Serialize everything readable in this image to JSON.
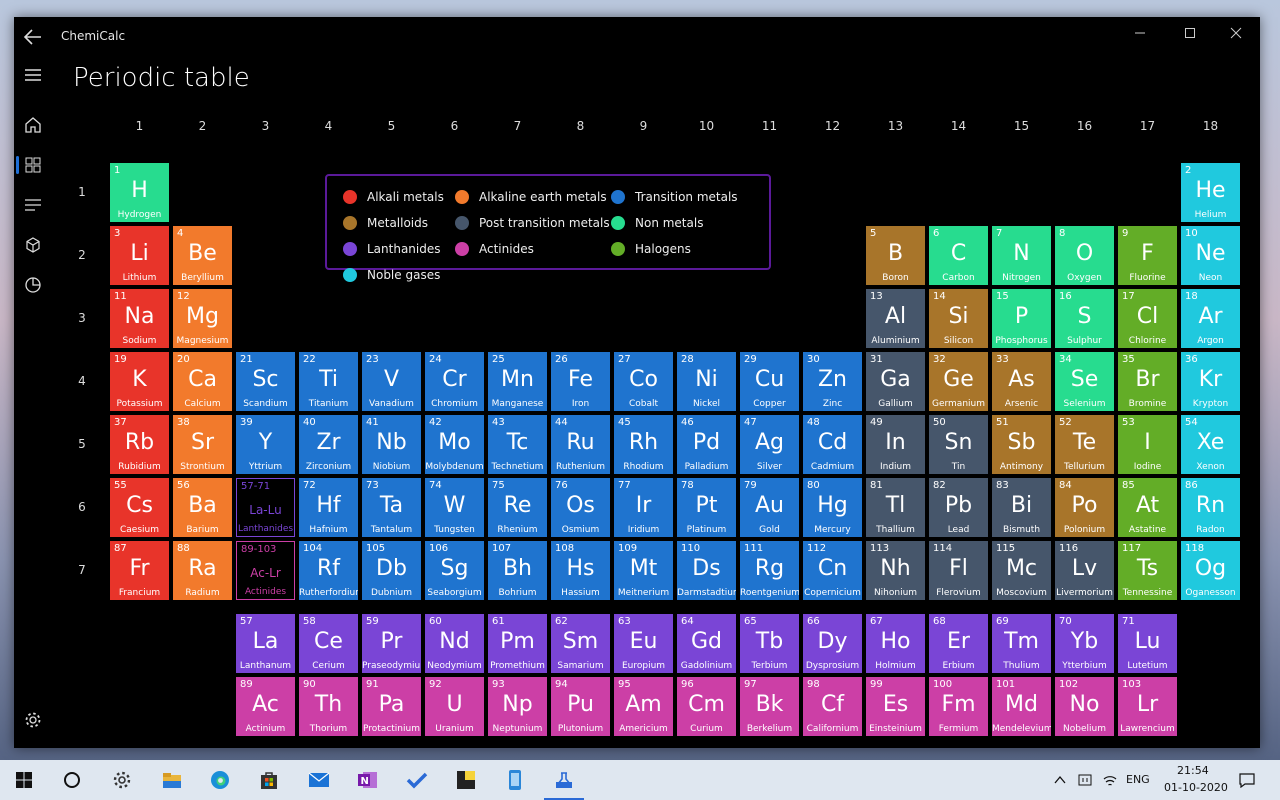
{
  "app": {
    "title": "ChemiCalc",
    "page_title": "Periodic table"
  },
  "nav": {
    "items": [
      "home-icon",
      "grid-icon",
      "list-icon",
      "cube-icon",
      "pie-chart-icon"
    ],
    "selected": "grid-icon",
    "settings_icon": "gear-icon"
  },
  "groups": [
    "1",
    "2",
    "3",
    "4",
    "5",
    "6",
    "7",
    "8",
    "9",
    "10",
    "11",
    "12",
    "13",
    "14",
    "15",
    "16",
    "17",
    "18"
  ],
  "periods": [
    "1",
    "2",
    "3",
    "4",
    "5",
    "6",
    "7"
  ],
  "legend": [
    {
      "label": "Alkali metals",
      "color": "#e8342a"
    },
    {
      "label": "Alkaline earth metals",
      "color": "#f27a2c"
    },
    {
      "label": "Transition metals",
      "color": "#1f74cf"
    },
    {
      "label": "Metalloids",
      "color": "#a8752a"
    },
    {
      "label": "Post transition metals",
      "color": "#46566b"
    },
    {
      "label": "Non metals",
      "color": "#27dc8f"
    },
    {
      "label": "Lanthanides",
      "color": "#7a45d6"
    },
    {
      "label": "Actinides",
      "color": "#cc3fa6"
    },
    {
      "label": "Halogens",
      "color": "#63ad27"
    },
    {
      "label": "Noble gases",
      "color": "#20c9de"
    }
  ],
  "category_colors": {
    "alkali": "#e8342a",
    "alkaline": "#f27a2c",
    "transition": "#1f74cf",
    "metalloid": "#a8752a",
    "post": "#46566b",
    "nonmetal": "#27dc8f",
    "lanthanide": "#7a45d6",
    "actinide": "#cc3fa6",
    "halogen": "#63ad27",
    "noble": "#20c9de"
  },
  "elements": [
    {
      "n": "1",
      "s": "H",
      "name": "Hydrogen",
      "g": 1,
      "p": 1,
      "c": "nonmetal"
    },
    {
      "n": "2",
      "s": "He",
      "name": "Helium",
      "g": 18,
      "p": 1,
      "c": "noble"
    },
    {
      "n": "3",
      "s": "Li",
      "name": "Lithium",
      "g": 1,
      "p": 2,
      "c": "alkali"
    },
    {
      "n": "4",
      "s": "Be",
      "name": "Beryllium",
      "g": 2,
      "p": 2,
      "c": "alkaline"
    },
    {
      "n": "5",
      "s": "B",
      "name": "Boron",
      "g": 13,
      "p": 2,
      "c": "metalloid"
    },
    {
      "n": "6",
      "s": "C",
      "name": "Carbon",
      "g": 14,
      "p": 2,
      "c": "nonmetal"
    },
    {
      "n": "7",
      "s": "N",
      "name": "Nitrogen",
      "g": 15,
      "p": 2,
      "c": "nonmetal"
    },
    {
      "n": "8",
      "s": "O",
      "name": "Oxygen",
      "g": 16,
      "p": 2,
      "c": "nonmetal"
    },
    {
      "n": "9",
      "s": "F",
      "name": "Fluorine",
      "g": 17,
      "p": 2,
      "c": "halogen"
    },
    {
      "n": "10",
      "s": "Ne",
      "name": "Neon",
      "g": 18,
      "p": 2,
      "c": "noble"
    },
    {
      "n": "11",
      "s": "Na",
      "name": "Sodium",
      "g": 1,
      "p": 3,
      "c": "alkali"
    },
    {
      "n": "12",
      "s": "Mg",
      "name": "Magnesium",
      "g": 2,
      "p": 3,
      "c": "alkaline"
    },
    {
      "n": "13",
      "s": "Al",
      "name": "Aluminium",
      "g": 13,
      "p": 3,
      "c": "post"
    },
    {
      "n": "14",
      "s": "Si",
      "name": "Silicon",
      "g": 14,
      "p": 3,
      "c": "metalloid"
    },
    {
      "n": "15",
      "s": "P",
      "name": "Phosphorus",
      "g": 15,
      "p": 3,
      "c": "nonmetal"
    },
    {
      "n": "16",
      "s": "S",
      "name": "Sulphur",
      "g": 16,
      "p": 3,
      "c": "nonmetal"
    },
    {
      "n": "17",
      "s": "Cl",
      "name": "Chlorine",
      "g": 17,
      "p": 3,
      "c": "halogen"
    },
    {
      "n": "18",
      "s": "Ar",
      "name": "Argon",
      "g": 18,
      "p": 3,
      "c": "noble"
    },
    {
      "n": "19",
      "s": "K",
      "name": "Potassium",
      "g": 1,
      "p": 4,
      "c": "alkali"
    },
    {
      "n": "20",
      "s": "Ca",
      "name": "Calcium",
      "g": 2,
      "p": 4,
      "c": "alkaline"
    },
    {
      "n": "21",
      "s": "Sc",
      "name": "Scandium",
      "g": 3,
      "p": 4,
      "c": "transition"
    },
    {
      "n": "22",
      "s": "Ti",
      "name": "Titanium",
      "g": 4,
      "p": 4,
      "c": "transition"
    },
    {
      "n": "23",
      "s": "V",
      "name": "Vanadium",
      "g": 5,
      "p": 4,
      "c": "transition"
    },
    {
      "n": "24",
      "s": "Cr",
      "name": "Chromium",
      "g": 6,
      "p": 4,
      "c": "transition"
    },
    {
      "n": "25",
      "s": "Mn",
      "name": "Manganese",
      "g": 7,
      "p": 4,
      "c": "transition"
    },
    {
      "n": "26",
      "s": "Fe",
      "name": "Iron",
      "g": 8,
      "p": 4,
      "c": "transition"
    },
    {
      "n": "27",
      "s": "Co",
      "name": "Cobalt",
      "g": 9,
      "p": 4,
      "c": "transition"
    },
    {
      "n": "28",
      "s": "Ni",
      "name": "Nickel",
      "g": 10,
      "p": 4,
      "c": "transition"
    },
    {
      "n": "29",
      "s": "Cu",
      "name": "Copper",
      "g": 11,
      "p": 4,
      "c": "transition"
    },
    {
      "n": "30",
      "s": "Zn",
      "name": "Zinc",
      "g": 12,
      "p": 4,
      "c": "transition"
    },
    {
      "n": "31",
      "s": "Ga",
      "name": "Gallium",
      "g": 13,
      "p": 4,
      "c": "post"
    },
    {
      "n": "32",
      "s": "Ge",
      "name": "Germanium",
      "g": 14,
      "p": 4,
      "c": "metalloid"
    },
    {
      "n": "33",
      "s": "As",
      "name": "Arsenic",
      "g": 15,
      "p": 4,
      "c": "metalloid"
    },
    {
      "n": "34",
      "s": "Se",
      "name": "Selenium",
      "g": 16,
      "p": 4,
      "c": "nonmetal"
    },
    {
      "n": "35",
      "s": "Br",
      "name": "Bromine",
      "g": 17,
      "p": 4,
      "c": "halogen"
    },
    {
      "n": "36",
      "s": "Kr",
      "name": "Krypton",
      "g": 18,
      "p": 4,
      "c": "noble"
    },
    {
      "n": "37",
      "s": "Rb",
      "name": "Rubidium",
      "g": 1,
      "p": 5,
      "c": "alkali"
    },
    {
      "n": "38",
      "s": "Sr",
      "name": "Strontium",
      "g": 2,
      "p": 5,
      "c": "alkaline"
    },
    {
      "n": "39",
      "s": "Y",
      "name": "Yttrium",
      "g": 3,
      "p": 5,
      "c": "transition"
    },
    {
      "n": "40",
      "s": "Zr",
      "name": "Zirconium",
      "g": 4,
      "p": 5,
      "c": "transition"
    },
    {
      "n": "41",
      "s": "Nb",
      "name": "Niobium",
      "g": 5,
      "p": 5,
      "c": "transition"
    },
    {
      "n": "42",
      "s": "Mo",
      "name": "Molybdenum",
      "g": 6,
      "p": 5,
      "c": "transition"
    },
    {
      "n": "43",
      "s": "Tc",
      "name": "Technetium",
      "g": 7,
      "p": 5,
      "c": "transition"
    },
    {
      "n": "44",
      "s": "Ru",
      "name": "Ruthenium",
      "g": 8,
      "p": 5,
      "c": "transition"
    },
    {
      "n": "45",
      "s": "Rh",
      "name": "Rhodium",
      "g": 9,
      "p": 5,
      "c": "transition"
    },
    {
      "n": "46",
      "s": "Pd",
      "name": "Palladium",
      "g": 10,
      "p": 5,
      "c": "transition"
    },
    {
      "n": "47",
      "s": "Ag",
      "name": "Silver",
      "g": 11,
      "p": 5,
      "c": "transition"
    },
    {
      "n": "48",
      "s": "Cd",
      "name": "Cadmium",
      "g": 12,
      "p": 5,
      "c": "transition"
    },
    {
      "n": "49",
      "s": "In",
      "name": "Indium",
      "g": 13,
      "p": 5,
      "c": "post"
    },
    {
      "n": "50",
      "s": "Sn",
      "name": "Tin",
      "g": 14,
      "p": 5,
      "c": "post"
    },
    {
      "n": "51",
      "s": "Sb",
      "name": "Antimony",
      "g": 15,
      "p": 5,
      "c": "metalloid"
    },
    {
      "n": "52",
      "s": "Te",
      "name": "Tellurium",
      "g": 16,
      "p": 5,
      "c": "metalloid"
    },
    {
      "n": "53",
      "s": "I",
      "name": "Iodine",
      "g": 17,
      "p": 5,
      "c": "halogen"
    },
    {
      "n": "54",
      "s": "Xe",
      "name": "Xenon",
      "g": 18,
      "p": 5,
      "c": "noble"
    },
    {
      "n": "55",
      "s": "Cs",
      "name": "Caesium",
      "g": 1,
      "p": 6,
      "c": "alkali"
    },
    {
      "n": "56",
      "s": "Ba",
      "name": "Barium",
      "g": 2,
      "p": 6,
      "c": "alkaline"
    },
    {
      "n": "57-71",
      "s": "La-Lu",
      "name": "Lanthanides",
      "g": 3,
      "p": 6,
      "c": "lanthanide",
      "ph": true
    },
    {
      "n": "72",
      "s": "Hf",
      "name": "Hafnium",
      "g": 4,
      "p": 6,
      "c": "transition"
    },
    {
      "n": "73",
      "s": "Ta",
      "name": "Tantalum",
      "g": 5,
      "p": 6,
      "c": "transition"
    },
    {
      "n": "74",
      "s": "W",
      "name": "Tungsten",
      "g": 6,
      "p": 6,
      "c": "transition"
    },
    {
      "n": "75",
      "s": "Re",
      "name": "Rhenium",
      "g": 7,
      "p": 6,
      "c": "transition"
    },
    {
      "n": "76",
      "s": "Os",
      "name": "Osmium",
      "g": 8,
      "p": 6,
      "c": "transition"
    },
    {
      "n": "77",
      "s": "Ir",
      "name": "Iridium",
      "g": 9,
      "p": 6,
      "c": "transition"
    },
    {
      "n": "78",
      "s": "Pt",
      "name": "Platinum",
      "g": 10,
      "p": 6,
      "c": "transition"
    },
    {
      "n": "79",
      "s": "Au",
      "name": "Gold",
      "g": 11,
      "p": 6,
      "c": "transition"
    },
    {
      "n": "80",
      "s": "Hg",
      "name": "Mercury",
      "g": 12,
      "p": 6,
      "c": "transition"
    },
    {
      "n": "81",
      "s": "Tl",
      "name": "Thallium",
      "g": 13,
      "p": 6,
      "c": "post"
    },
    {
      "n": "82",
      "s": "Pb",
      "name": "Lead",
      "g": 14,
      "p": 6,
      "c": "post"
    },
    {
      "n": "83",
      "s": "Bi",
      "name": "Bismuth",
      "g": 15,
      "p": 6,
      "c": "post"
    },
    {
      "n": "84",
      "s": "Po",
      "name": "Polonium",
      "g": 16,
      "p": 6,
      "c": "metalloid"
    },
    {
      "n": "85",
      "s": "At",
      "name": "Astatine",
      "g": 17,
      "p": 6,
      "c": "halogen"
    },
    {
      "n": "86",
      "s": "Rn",
      "name": "Radon",
      "g": 18,
      "p": 6,
      "c": "noble"
    },
    {
      "n": "87",
      "s": "Fr",
      "name": "Francium",
      "g": 1,
      "p": 7,
      "c": "alkali"
    },
    {
      "n": "88",
      "s": "Ra",
      "name": "Radium",
      "g": 2,
      "p": 7,
      "c": "alkaline"
    },
    {
      "n": "89-103",
      "s": "Ac-Lr",
      "name": "Actinides",
      "g": 3,
      "p": 7,
      "c": "actinide",
      "ph": true
    },
    {
      "n": "104",
      "s": "Rf",
      "name": "Rutherfordium",
      "g": 4,
      "p": 7,
      "c": "transition"
    },
    {
      "n": "105",
      "s": "Db",
      "name": "Dubnium",
      "g": 5,
      "p": 7,
      "c": "transition"
    },
    {
      "n": "106",
      "s": "Sg",
      "name": "Seaborgium",
      "g": 6,
      "p": 7,
      "c": "transition"
    },
    {
      "n": "107",
      "s": "Bh",
      "name": "Bohrium",
      "g": 7,
      "p": 7,
      "c": "transition"
    },
    {
      "n": "108",
      "s": "Hs",
      "name": "Hassium",
      "g": 8,
      "p": 7,
      "c": "transition"
    },
    {
      "n": "109",
      "s": "Mt",
      "name": "Meitnerium",
      "g": 9,
      "p": 7,
      "c": "transition"
    },
    {
      "n": "110",
      "s": "Ds",
      "name": "Darmstadtium",
      "g": 10,
      "p": 7,
      "c": "transition"
    },
    {
      "n": "111",
      "s": "Rg",
      "name": "Roentgenium",
      "g": 11,
      "p": 7,
      "c": "transition"
    },
    {
      "n": "112",
      "s": "Cn",
      "name": "Copernicium",
      "g": 12,
      "p": 7,
      "c": "transition"
    },
    {
      "n": "113",
      "s": "Nh",
      "name": "Nihonium",
      "g": 13,
      "p": 7,
      "c": "post"
    },
    {
      "n": "114",
      "s": "Fl",
      "name": "Flerovium",
      "g": 14,
      "p": 7,
      "c": "post"
    },
    {
      "n": "115",
      "s": "Mc",
      "name": "Moscovium",
      "g": 15,
      "p": 7,
      "c": "post"
    },
    {
      "n": "116",
      "s": "Lv",
      "name": "Livermorium",
      "g": 16,
      "p": 7,
      "c": "post"
    },
    {
      "n": "117",
      "s": "Ts",
      "name": "Tennessine",
      "g": 17,
      "p": 7,
      "c": "halogen"
    },
    {
      "n": "118",
      "s": "Og",
      "name": "Oganesson",
      "g": 18,
      "p": 7,
      "c": "noble"
    },
    {
      "n": "57",
      "s": "La",
      "name": "Lanthanum",
      "g": 3,
      "p": 9,
      "c": "lanthanide"
    },
    {
      "n": "58",
      "s": "Ce",
      "name": "Cerium",
      "g": 4,
      "p": 9,
      "c": "lanthanide"
    },
    {
      "n": "59",
      "s": "Pr",
      "name": "Praseodymium",
      "g": 5,
      "p": 9,
      "c": "lanthanide"
    },
    {
      "n": "60",
      "s": "Nd",
      "name": "Neodymium",
      "g": 6,
      "p": 9,
      "c": "lanthanide"
    },
    {
      "n": "61",
      "s": "Pm",
      "name": "Promethium",
      "g": 7,
      "p": 9,
      "c": "lanthanide"
    },
    {
      "n": "62",
      "s": "Sm",
      "name": "Samarium",
      "g": 8,
      "p": 9,
      "c": "lanthanide"
    },
    {
      "n": "63",
      "s": "Eu",
      "name": "Europium",
      "g": 9,
      "p": 9,
      "c": "lanthanide"
    },
    {
      "n": "64",
      "s": "Gd",
      "name": "Gadolinium",
      "g": 10,
      "p": 9,
      "c": "lanthanide"
    },
    {
      "n": "65",
      "s": "Tb",
      "name": "Terbium",
      "g": 11,
      "p": 9,
      "c": "lanthanide"
    },
    {
      "n": "66",
      "s": "Dy",
      "name": "Dysprosium",
      "g": 12,
      "p": 9,
      "c": "lanthanide"
    },
    {
      "n": "67",
      "s": "Ho",
      "name": "Holmium",
      "g": 13,
      "p": 9,
      "c": "lanthanide"
    },
    {
      "n": "68",
      "s": "Er",
      "name": "Erbium",
      "g": 14,
      "p": 9,
      "c": "lanthanide"
    },
    {
      "n": "69",
      "s": "Tm",
      "name": "Thulium",
      "g": 15,
      "p": 9,
      "c": "lanthanide"
    },
    {
      "n": "70",
      "s": "Yb",
      "name": "Ytterbium",
      "g": 16,
      "p": 9,
      "c": "lanthanide"
    },
    {
      "n": "71",
      "s": "Lu",
      "name": "Lutetium",
      "g": 17,
      "p": 9,
      "c": "lanthanide"
    },
    {
      "n": "89",
      "s": "Ac",
      "name": "Actinium",
      "g": 3,
      "p": 10,
      "c": "actinide"
    },
    {
      "n": "90",
      "s": "Th",
      "name": "Thorium",
      "g": 4,
      "p": 10,
      "c": "actinide"
    },
    {
      "n": "91",
      "s": "Pa",
      "name": "Protactinium",
      "g": 5,
      "p": 10,
      "c": "actinide"
    },
    {
      "n": "92",
      "s": "U",
      "name": "Uranium",
      "g": 6,
      "p": 10,
      "c": "actinide"
    },
    {
      "n": "93",
      "s": "Np",
      "name": "Neptunium",
      "g": 7,
      "p": 10,
      "c": "actinide"
    },
    {
      "n": "94",
      "s": "Pu",
      "name": "Plutonium",
      "g": 8,
      "p": 10,
      "c": "actinide"
    },
    {
      "n": "95",
      "s": "Am",
      "name": "Americium",
      "g": 9,
      "p": 10,
      "c": "actinide"
    },
    {
      "n": "96",
      "s": "Cm",
      "name": "Curium",
      "g": 10,
      "p": 10,
      "c": "actinide"
    },
    {
      "n": "97",
      "s": "Bk",
      "name": "Berkelium",
      "g": 11,
      "p": 10,
      "c": "actinide"
    },
    {
      "n": "98",
      "s": "Cf",
      "name": "Californium",
      "g": 12,
      "p": 10,
      "c": "actinide"
    },
    {
      "n": "99",
      "s": "Es",
      "name": "Einsteinium",
      "g": 13,
      "p": 10,
      "c": "actinide"
    },
    {
      "n": "100",
      "s": "Fm",
      "name": "Fermium",
      "g": 14,
      "p": 10,
      "c": "actinide"
    },
    {
      "n": "101",
      "s": "Md",
      "name": "Mendelevium",
      "g": 15,
      "p": 10,
      "c": "actinide"
    },
    {
      "n": "102",
      "s": "No",
      "name": "Nobelium",
      "g": 16,
      "p": 10,
      "c": "actinide"
    },
    {
      "n": "103",
      "s": "Lr",
      "name": "Lawrencium",
      "g": 17,
      "p": 10,
      "c": "actinide"
    }
  ],
  "taskbar": {
    "apps": [
      "windows-start-icon",
      "cortana-icon",
      "settings-icon",
      "file-explorer-icon",
      "edge-icon",
      "store-icon",
      "mail-icon",
      "onenote-icon",
      "todo-icon",
      "sticky-notes-icon",
      "phone-icon",
      "chemicalc-icon"
    ],
    "active": "chemicalc-icon",
    "language": "ENG",
    "time": "21:54",
    "date": "01-10-2020"
  }
}
